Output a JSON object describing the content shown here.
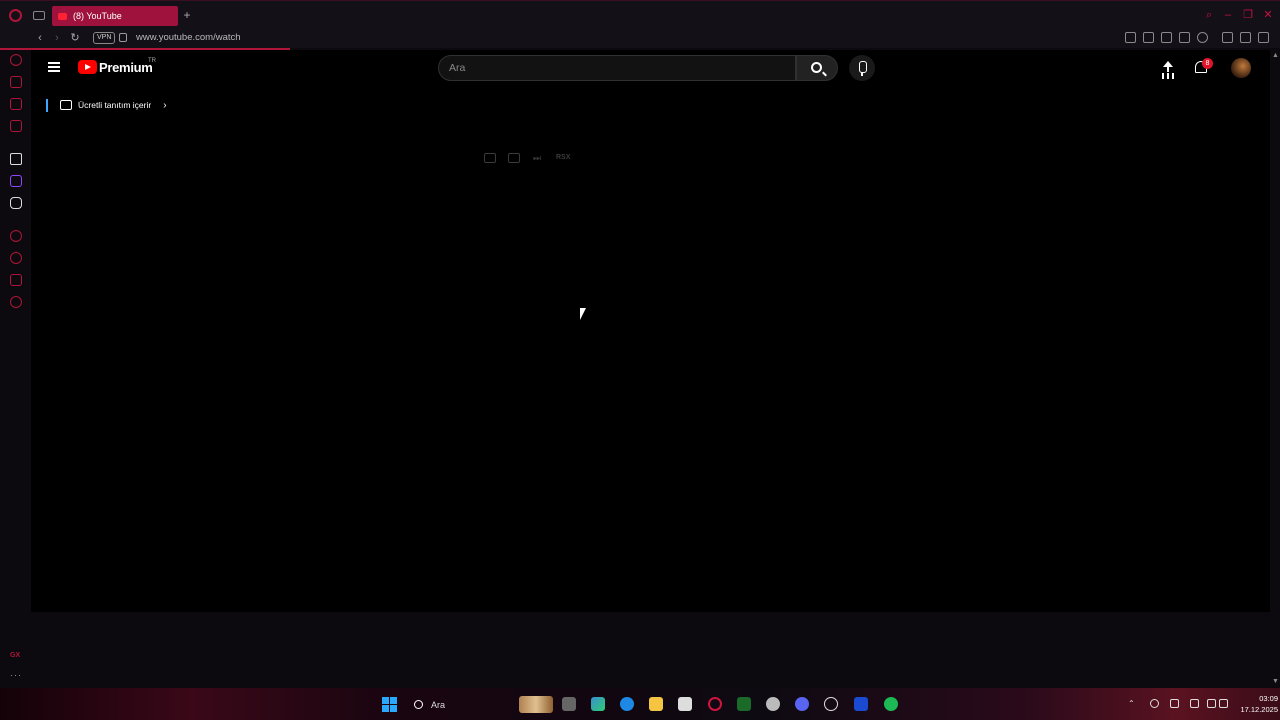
{
  "browser": {
    "tab": {
      "title": "(8) YouTube"
    },
    "new_tab_symbol": "+",
    "nav": {
      "back": "‹",
      "forward": "›",
      "reload": "↻"
    },
    "vpn_label": "VPN",
    "url": "www.youtube.com/watch"
  },
  "sidebar": {
    "gx_label": "GX",
    "more_label": "···"
  },
  "youtube": {
    "logo_text": "Premium",
    "country_code": "TR",
    "search_placeholder": "Ara",
    "notification_count": "8",
    "promo_text": "Ücretli tanıtım içerir",
    "promo_chevron": "›",
    "speed_label": "RSX"
  },
  "taskbar": {
    "search_label": "Ara",
    "time": "03:09",
    "date": "17.12.2025"
  },
  "colors": {
    "accent": "#b01438",
    "youtube_red": "#ff0000",
    "windows_blue": "#29a8ff"
  }
}
